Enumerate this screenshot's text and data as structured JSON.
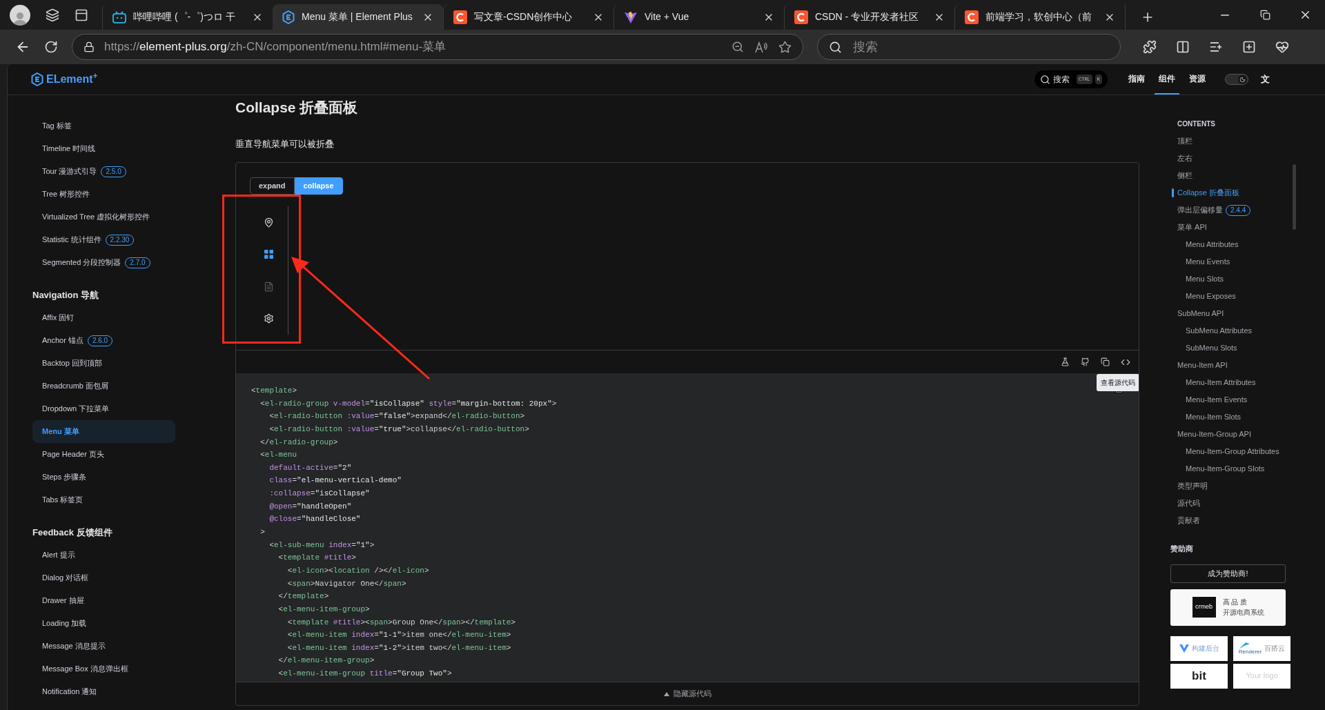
{
  "browser": {
    "tabs": [
      {
        "title": "哔哩哔哩 (゜-゜)つロ 干",
        "kind": "bilibili",
        "selected": false
      },
      {
        "title": "Menu 菜单 | Element Plus",
        "kind": "element",
        "selected": true
      },
      {
        "title": "写文章-CSDN创作中心",
        "kind": "csdn",
        "selected": false
      },
      {
        "title": "Vite + Vue",
        "kind": "vite",
        "selected": false
      },
      {
        "title": "CSDN - 专业开发者社区",
        "kind": "csdn",
        "selected": false
      },
      {
        "title": "前端学习，软创中心（前",
        "kind": "csdn",
        "selected": false
      }
    ],
    "url": {
      "scheme": "https://",
      "host": "element-plus.org",
      "path": "/zh-CN/component/menu.html#menu-菜单"
    },
    "search": {
      "placeholder": "搜索"
    }
  },
  "site_header": {
    "logo": "ELement$^{+}$",
    "search": {
      "placeholder": "搜索",
      "keys": [
        "CTRL",
        "K"
      ]
    },
    "nav": [
      {
        "label": "指南",
        "selected": false
      },
      {
        "label": "组件",
        "selected": true
      },
      {
        "label": "资源",
        "selected": false
      }
    ],
    "dark_mode": {
      "on": true
    },
    "language": "文"
  },
  "sidebar": {
    "groups": [
      {
        "items": [
          {
            "label": "Tag 标签",
            "selected": false
          },
          {
            "label": "Timeline 时间线",
            "selected": false
          },
          {
            "label": "Tour 漫游式引导",
            "badge": "2.5.0",
            "selected": false
          },
          {
            "label": "Tree 树形控件",
            "selected": false
          },
          {
            "label": "Virtualized Tree 虚拟化树形控件",
            "selected": false
          },
          {
            "label": "Statistic 统计组件",
            "badge": "2.2.30",
            "selected": false
          },
          {
            "label": "Segmented 分段控制器",
            "badge": "2.7.0",
            "selected": false
          }
        ]
      },
      {
        "title": "Navigation 导航",
        "items": [
          {
            "label": "Affix 固钉",
            "selected": false
          },
          {
            "label": "Anchor 锚点",
            "badge": "2.6.0",
            "selected": false
          },
          {
            "label": "Backtop 回到顶部",
            "selected": false
          },
          {
            "label": "Breadcrumb 面包屑",
            "selected": false
          },
          {
            "label": "Dropdown 下拉菜单",
            "selected": false
          },
          {
            "label": "Menu 菜单",
            "selected": true
          },
          {
            "label": "Page Header 页头",
            "selected": false
          },
          {
            "label": "Steps 步骤条",
            "selected": false
          },
          {
            "label": "Tabs 标签页",
            "selected": false
          }
        ]
      },
      {
        "title": "Feedback 反馈组件",
        "items": [
          {
            "label": "Alert 提示",
            "selected": false
          },
          {
            "label": "Dialog 对话框",
            "selected": false
          },
          {
            "label": "Drawer 抽屉",
            "selected": false
          },
          {
            "label": "Loading 加载",
            "selected": false
          },
          {
            "label": "Message 消息提示",
            "selected": false
          },
          {
            "label": "Message Box 消息弹出框",
            "selected": false
          },
          {
            "label": "Notification 通知",
            "selected": false
          }
        ]
      }
    ]
  },
  "main": {
    "title": "Collapse 折叠面板",
    "description": "垂直导航菜单可以被折叠",
    "radio": [
      {
        "label": "expand",
        "selected": false
      },
      {
        "label": "collapse",
        "selected": true
      }
    ],
    "menu": [
      {
        "kind": "location",
        "selected": false,
        "disabled": false
      },
      {
        "kind": "grid",
        "selected": true,
        "disabled": false
      },
      {
        "kind": "document",
        "selected": false,
        "disabled": true
      },
      {
        "kind": "setting",
        "selected": false,
        "disabled": false
      }
    ],
    "tooltip": "查看源代码",
    "code": [
      "<template>",
      "  <el-radio-group v-model=\"isCollapse\" style=\"margin-bottom: 20px\">",
      "    <el-radio-button :value=\"false\">expand</el-radio-button>",
      "    <el-radio-button :value=\"true\">collapse</el-radio-button>",
      "  </el-radio-group>",
      "  <el-menu",
      "    default-active=\"2\"",
      "    class=\"el-menu-vertical-demo\"",
      "    :collapse=\"isCollapse\"",
      "    @open=\"handleOpen\"",
      "    @close=\"handleClose\"",
      "  >",
      "    <el-sub-menu index=\"1\">",
      "      <template #title>",
      "        <el-icon><location /></el-icon>",
      "        <span>Navigator One</span>",
      "      </template>",
      "      <el-menu-item-group>",
      "        <template #title><span>Group One</span></template>",
      "        <el-menu-item index=\"1-1\">item one</el-menu-item>",
      "        <el-menu-item index=\"1-2\">item two</el-menu-item>",
      "      </el-menu-item-group>",
      "      <el-menu-item-group title=\"Group Two\">"
    ],
    "hide_code": "隐藏源代码"
  },
  "toc": {
    "title": "CONTENTS",
    "items": [
      {
        "label": "顶栏",
        "selected": false
      },
      {
        "label": "左右",
        "selected": false
      },
      {
        "label": "侧栏",
        "selected": false
      },
      {
        "label": "Collapse 折叠面板",
        "selected": true
      },
      {
        "label": "弹出层偏移量",
        "badge": "2.4.4",
        "selected": false
      },
      {
        "label": "菜单 API",
        "selected": false,
        "children": [
          {
            "label": "Menu Attributes",
            "selected": false
          },
          {
            "label": "Menu Events",
            "selected": false
          },
          {
            "label": "Menu Slots",
            "selected": false
          },
          {
            "label": "Menu Exposes",
            "selected": false
          }
        ]
      },
      {
        "label": "SubMenu API",
        "selected": false,
        "children": [
          {
            "label": "SubMenu Attributes",
            "selected": false
          },
          {
            "label": "SubMenu Slots",
            "selected": false
          }
        ]
      },
      {
        "label": "Menu-Item API",
        "selected": false,
        "children": [
          {
            "label": "Menu-Item Attributes",
            "selected": false
          },
          {
            "label": "Menu-Item Events",
            "selected": false
          },
          {
            "label": "Menu-Item Slots",
            "selected": false
          }
        ]
      },
      {
        "label": "Menu-Item-Group API",
        "selected": false,
        "children": [
          {
            "label": "Menu-Item-Group Attributes",
            "selected": false
          },
          {
            "label": "Menu-Item-Group Slots",
            "selected": false
          }
        ]
      },
      {
        "label": "类型声明",
        "selected": false
      },
      {
        "label": "源代码",
        "selected": false
      },
      {
        "label": "贡献者",
        "selected": false
      }
    ],
    "sponsors_title": "赞助商",
    "sponsor_button": "成为赞助商!",
    "sponsor_main": {
      "logo": "crmeb",
      "title": "高 品 质",
      "subtitle": "开源电商系统"
    },
    "sponsors": [
      {
        "kind": "vue",
        "label": "构建后台"
      },
      {
        "kind": "renderer",
        "label": "百搭云",
        "sub": "Renderer"
      },
      {
        "kind": "bit",
        "label": "bit"
      },
      {
        "kind": "placeholder",
        "label": "Your logo"
      }
    ]
  }
}
